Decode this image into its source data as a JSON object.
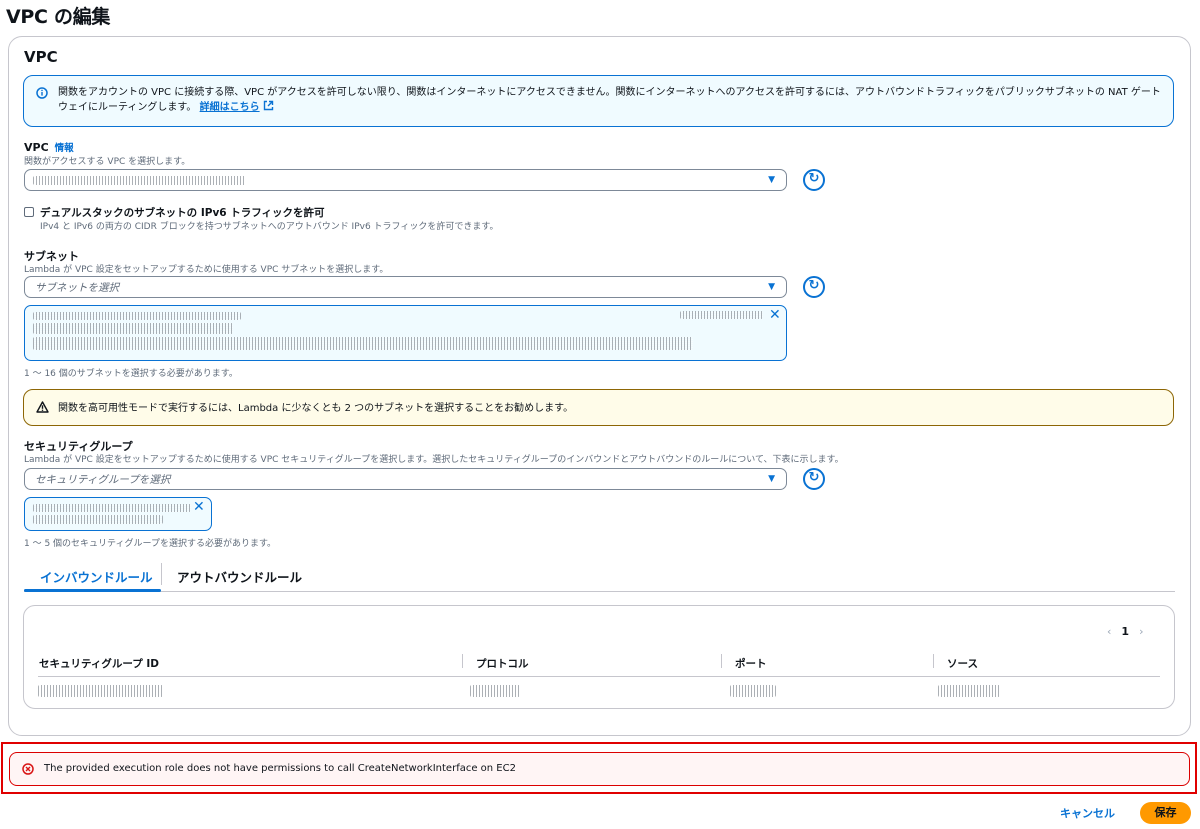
{
  "page_title": "VPC の編集",
  "panel_title": "VPC",
  "info_flash": {
    "text": "関数をアカウントの VPC に接続する際、VPC がアクセスを許可しない限り、関数はインターネットにアクセスできません。関数にインターネットへのアクセスを許可するには、アウトバウンドトラフィックをパブリックサブネットの NAT ゲートウェイにルーティングします。",
    "link_label": "詳細はこちら"
  },
  "vpc_field": {
    "label": "VPC",
    "info_link": "情報",
    "description": "関数がアクセスする VPC を選択します。"
  },
  "ipv6": {
    "label": "デュアルスタックのサブネットの IPv6 トラフィックを許可",
    "description": "IPv4 と IPv6 の両方の CIDR ブロックを持つサブネットへのアウトバウンド IPv6 トラフィックを許可できます。"
  },
  "subnet_field": {
    "label": "サブネット",
    "description": "Lambda が VPC 設定をセットアップするために使用する VPC サブネットを選択します。",
    "placeholder": "サブネットを選択",
    "constraint": "1 ～ 16 個のサブネットを選択する必要があります。"
  },
  "warning_flash": {
    "text": "関数を高可用性モードで実行するには、Lambda に少なくとも 2 つのサブネットを選択することをお勧めします。"
  },
  "sg_field": {
    "label": "セキュリティグループ",
    "description": "Lambda が VPC 設定をセットアップするために使用する VPC セキュリティグループを選択します。選択したセキュリティグループのインバウンドとアウトバウンドのルールについて、下表に示します。",
    "placeholder": "セキュリティグループを選択",
    "constraint": "1 ～ 5 個のセキュリティグループを選択する必要があります。"
  },
  "tabs": [
    {
      "label": "インバウンドルール",
      "active": true
    },
    {
      "label": "アウトバウンドルール",
      "active": false
    }
  ],
  "rules_table": {
    "page": "1",
    "columns": [
      "セキュリティグループ ID",
      "プロトコル",
      "ポート",
      "ソース"
    ]
  },
  "error_flash": {
    "text": "The provided execution role does not have permissions to call CreateNetworkInterface on EC2"
  },
  "actions": {
    "cancel_label": "キャンセル",
    "save_label": "保存"
  },
  "icons": {
    "info": "info-circle-icon",
    "warning": "warning-triangle-icon",
    "error": "error-circle-icon",
    "refresh": "refresh-icon",
    "external": "external-link-icon",
    "dismiss": "close-icon",
    "caret": "caret-down-icon"
  },
  "colors": {
    "accent": "#0972d3",
    "primary_button": "#ff9900",
    "error": "#d91515",
    "error_highlight": "#e00000",
    "info_bg": "#f0fbff",
    "warning_border": "#8d6605"
  }
}
